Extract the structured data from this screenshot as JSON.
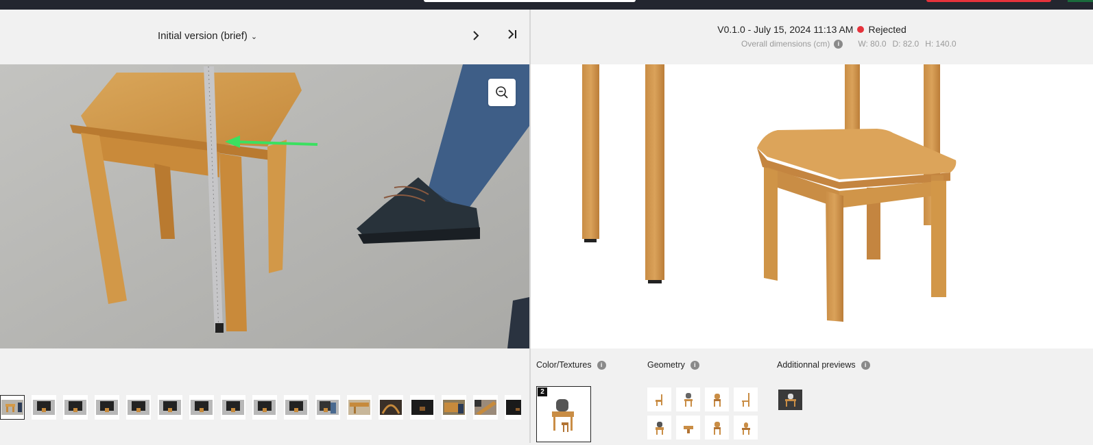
{
  "left": {
    "version_label": "Initial version (brief)",
    "next_label": "›",
    "last_label": "›|",
    "thumbnails": [
      "stool-side",
      "stool-front",
      "stool-front",
      "stool-front",
      "stool-front",
      "stool-front",
      "stool-front",
      "stool-front",
      "stool-front",
      "stool-front",
      "stool-person",
      "stool-wood",
      "stool-arch",
      "stool-dark",
      "stool-table",
      "stool-leg",
      "stool-dark"
    ]
  },
  "right": {
    "version": "V0.1.0 - July 15, 2024 11:13 AM",
    "status": "Rejected",
    "status_color": "#e5323b",
    "dimensions_label": "Overall dimensions (cm)",
    "width": "W: 80.0",
    "depth": "D: 82.0",
    "height": "H: 140.0",
    "sections": {
      "color_textures": "Color/Textures",
      "geometry": "Geometry",
      "additional_previews": "Additionnal previews"
    },
    "color_badge": "2",
    "info_glyph": "i"
  }
}
